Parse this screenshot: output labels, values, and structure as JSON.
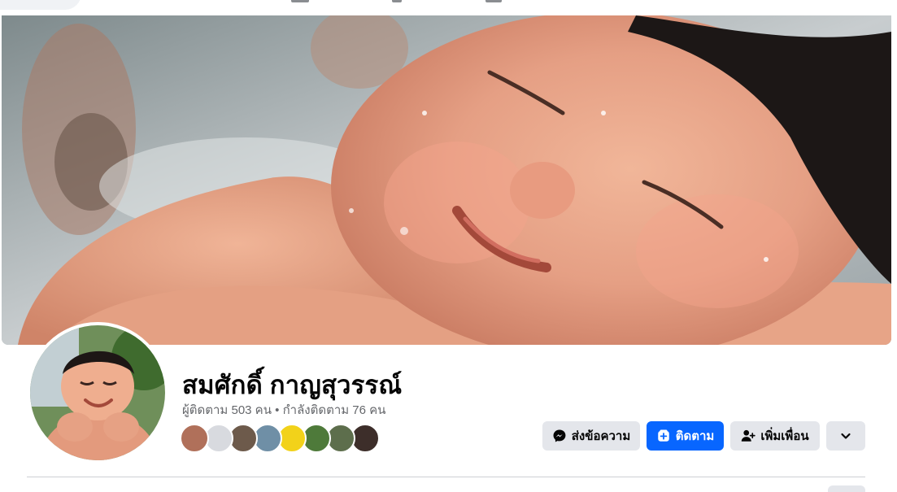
{
  "profile": {
    "name": "สมศักดิ์ กาญสุวรรณ์",
    "followers_label": "ผู้ติดตาม 503 คน",
    "separator": " • ",
    "following_label": "กำลังติดตาม 76 คน"
  },
  "actions": {
    "message_label": "ส่งข้อความ",
    "follow_label": "ติดตาม",
    "add_friend_label": "เพิ่มเพื่อน"
  },
  "mutual_friends": [
    {
      "icon": "friend-avatar-1",
      "color": "#b0705a"
    },
    {
      "icon": "friend-avatar-placeholder",
      "color": "#d8dadf"
    },
    {
      "icon": "friend-avatar-3",
      "color": "#6d5a4b"
    },
    {
      "icon": "friend-avatar-4",
      "color": "#6f8fa6"
    },
    {
      "icon": "friend-avatar-5",
      "color": "#f2d21a"
    },
    {
      "icon": "friend-avatar-6",
      "color": "#4e7a3a"
    },
    {
      "icon": "friend-avatar-7",
      "color": "#5d6e4c"
    },
    {
      "icon": "friend-avatar-8",
      "color": "#3d2e2a"
    }
  ],
  "colors": {
    "primary_blue": "#0866ff",
    "secondary_button": "#e4e6eb",
    "text_primary": "#050505",
    "text_secondary": "#65676b"
  }
}
